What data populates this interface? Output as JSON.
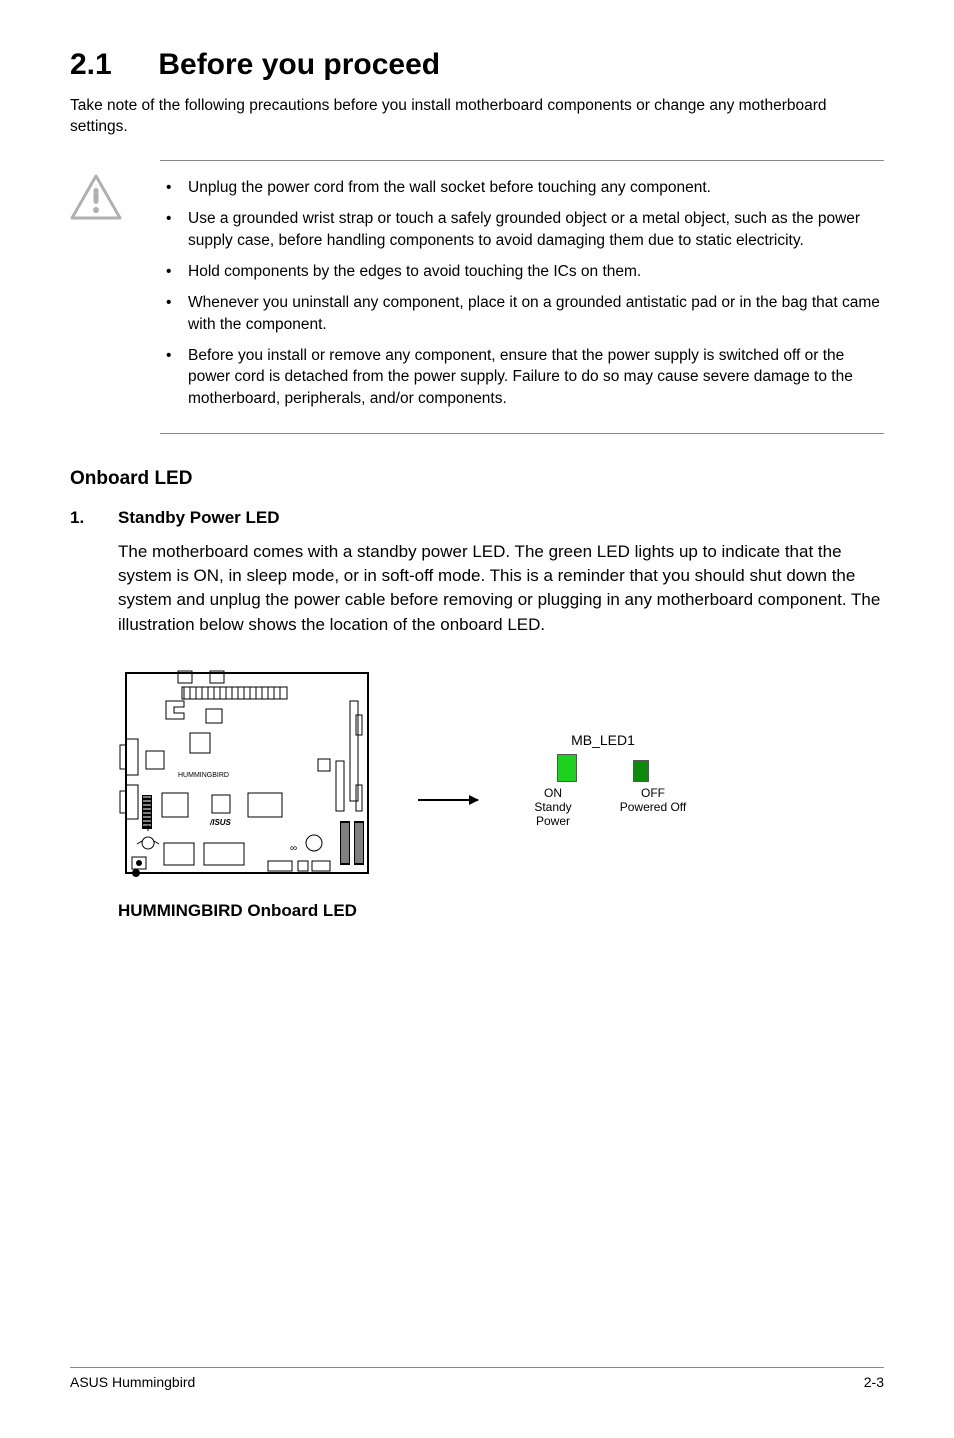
{
  "section": {
    "number": "2.1",
    "title": "Before you proceed"
  },
  "intro": "Take note of the following precautions before you install motherboard components or change any motherboard settings.",
  "warnings": [
    "Unplug the power cord from the wall socket before touching any component.",
    "Use a grounded wrist strap or touch a safely grounded object or a metal object, such as the power supply case, before handling components to avoid damaging them due to static electricity.",
    "Hold components by the edges to avoid touching the ICs on them.",
    "Whenever you uninstall any component, place it on a grounded antistatic pad or in the bag that came with the component.",
    "Before you install or remove any component, ensure that the power supply is switched off or the power cord is detached from the power supply. Failure to do so may cause severe damage to the motherboard, peripherals, and/or components."
  ],
  "onboard_led": {
    "heading": "Onboard LED",
    "item_number": "1.",
    "item_title": "Standby Power LED",
    "body": "The motherboard comes with a standby power LED. The green LED lights up to indicate that the system is ON, in sleep mode, or in soft-off mode. This is a reminder that you should shut down the system and unplug the power cable before removing or plugging in any motherboard component. The illustration below shows the location of the onboard LED."
  },
  "diagram": {
    "led_label": "MB_LED1",
    "on_label_top": "ON",
    "on_label_bottom": "Standy Power",
    "off_label_top": "OFF",
    "off_label_bottom": "Powered Off",
    "caption": "HUMMINGBIRD Onboard LED",
    "board_text": "HUMMINGBIRD"
  },
  "footer": {
    "left": "ASUS Hummingbird",
    "right": "2-3"
  }
}
